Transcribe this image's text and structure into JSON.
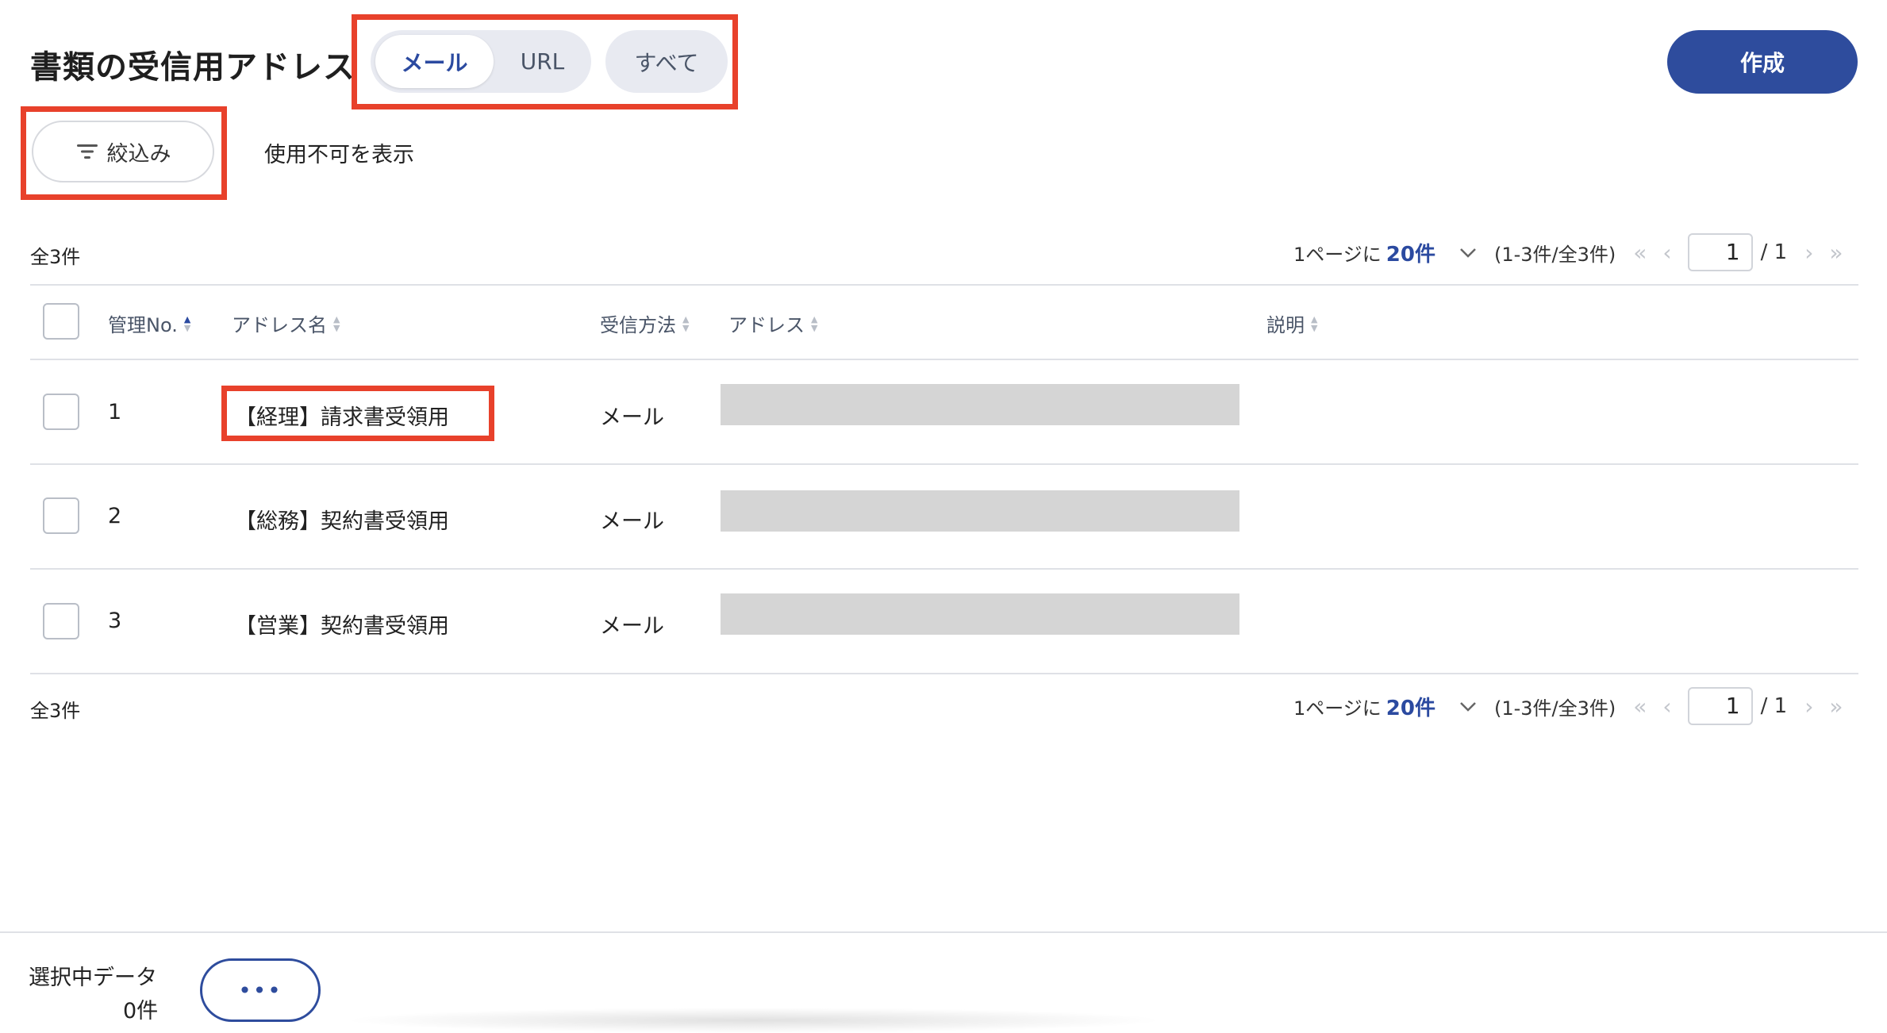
{
  "header": {
    "title": "書類の受信用アドレス",
    "tabs": [
      {
        "label": "メール",
        "active": true
      },
      {
        "label": "URL",
        "active": false
      }
    ],
    "all_label": "すべて",
    "create_label": "作成"
  },
  "filters": {
    "filter_label": "絞込み",
    "show_disabled_label": "使用不可を表示"
  },
  "summary": {
    "count_label": "全3件",
    "per_page_prefix": "1ページに",
    "per_page_value": "20件",
    "range": "(1-3件/全3件)",
    "current_page": "1",
    "total_pages": "/ 1",
    "nav_first": "«",
    "nav_prev": "‹",
    "nav_next": "›",
    "nav_last": "»"
  },
  "table": {
    "columns": [
      "管理No.",
      "アドレス名",
      "受信方法",
      "アドレス",
      "説明"
    ],
    "rows": [
      {
        "no": "1",
        "name": "【経理】請求書受領用",
        "method": "メール"
      },
      {
        "no": "2",
        "name": "【総務】契約書受領用",
        "method": "メール"
      },
      {
        "no": "3",
        "name": "【営業】契約書受領用",
        "method": "メール"
      }
    ]
  },
  "footer": {
    "selected_label": "選択中データ",
    "selected_count": "0件",
    "more_label": "•••"
  },
  "colors": {
    "accent": "#2e4c9d",
    "highlight": "#e8412b",
    "redacted": "#d5d5d5"
  }
}
